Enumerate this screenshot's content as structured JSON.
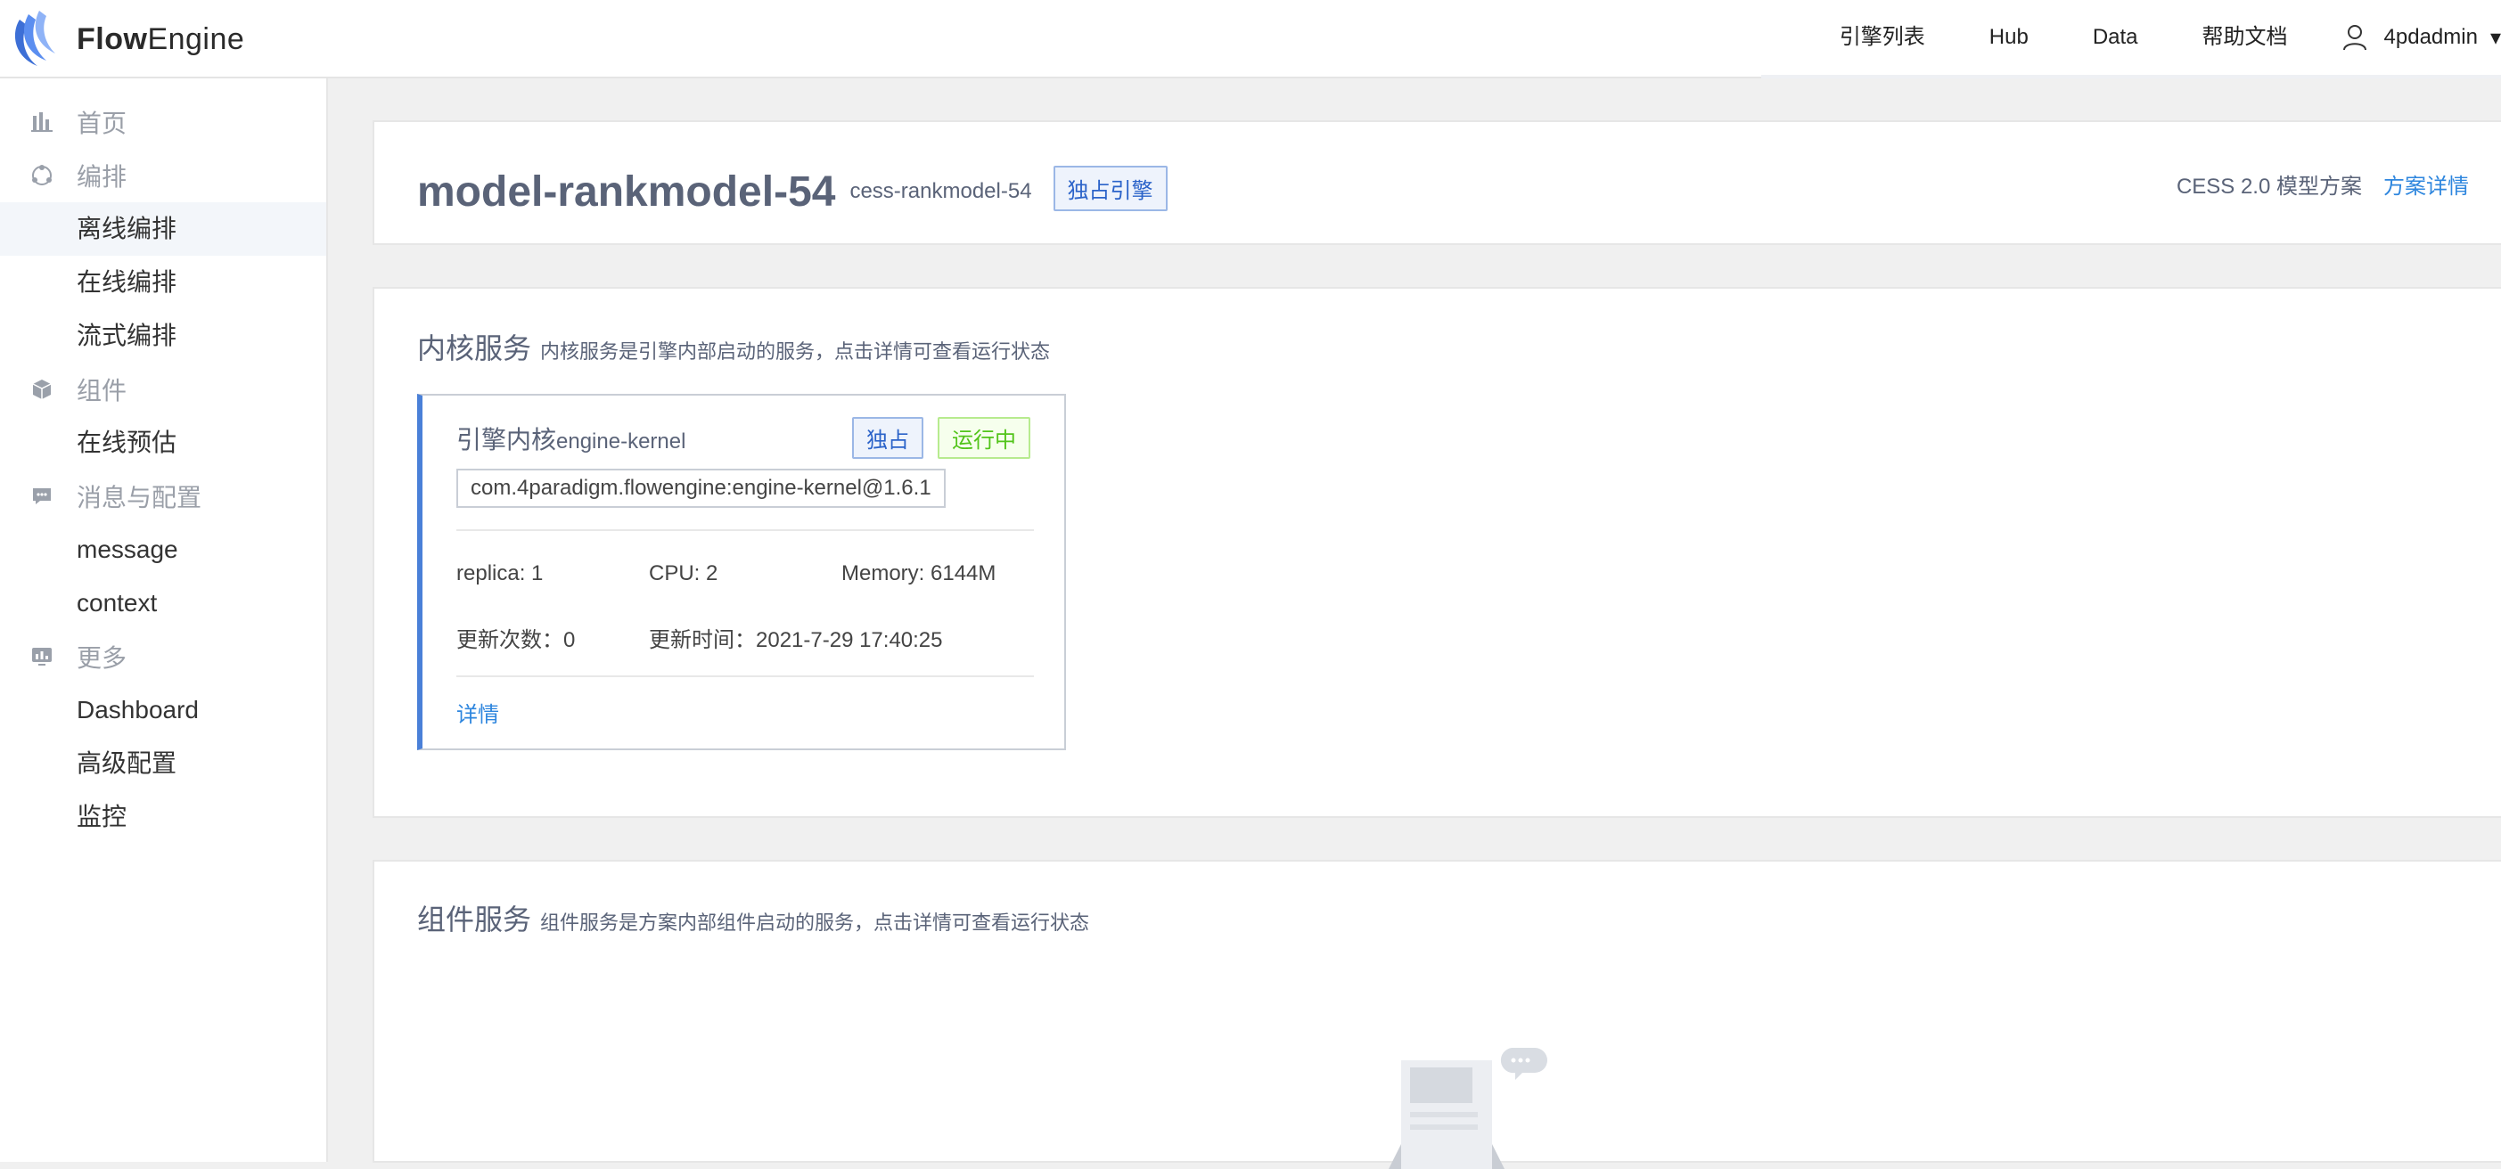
{
  "app": {
    "logo_bold": "Flow",
    "logo_rest": "Engine"
  },
  "nav": {
    "items": [
      "引擎列表",
      "Hub",
      "Data",
      "帮助文档"
    ],
    "user": "4pdadmin"
  },
  "sidebar": {
    "groups": [
      {
        "label": "首页",
        "icon": "bar-chart-icon",
        "children": []
      },
      {
        "label": "编排",
        "icon": "orchestration-icon",
        "children": [
          "离线编排",
          "在线编排",
          "流式编排"
        ]
      },
      {
        "label": "组件",
        "icon": "cube-icon",
        "children": [
          "在线预估"
        ]
      },
      {
        "label": "消息与配置",
        "icon": "message-icon",
        "children": [
          "message",
          "context"
        ]
      },
      {
        "label": "更多",
        "icon": "more-icon",
        "children": [
          "Dashboard",
          "高级配置",
          "监控"
        ]
      }
    ],
    "active": "离线编排"
  },
  "header": {
    "title": "model-rankmodel-54",
    "subtitle": "cess-rankmodel-54",
    "tag": "独占引擎",
    "scheme_name": "CESS 2.0 模型方案",
    "scheme_link": "方案详情"
  },
  "kernel_section": {
    "title": "内核服务",
    "desc": "内核服务是引擎内部启动的服务，点击详情可查看运行状态",
    "card": {
      "name_cn": "引擎内核",
      "name_en": "engine-kernel",
      "tag_exclusive": "独占",
      "tag_status": "运行中",
      "package": "com.4paradigm.flowengine:engine-kernel@1.6.1",
      "replica": "replica: 1",
      "cpu": "CPU: 2",
      "memory": "Memory: 6144M",
      "update_count": "更新次数：0",
      "update_time": "更新时间：2021-7-29 17:40:25",
      "detail": "详情"
    }
  },
  "component_section": {
    "title": "组件服务",
    "desc": "组件服务是方案内部组件启动的服务，点击详情可查看运行状态"
  },
  "colors": {
    "accent": "#2e86de",
    "running": "#52c41a",
    "card_bar": "#4a80d8"
  }
}
